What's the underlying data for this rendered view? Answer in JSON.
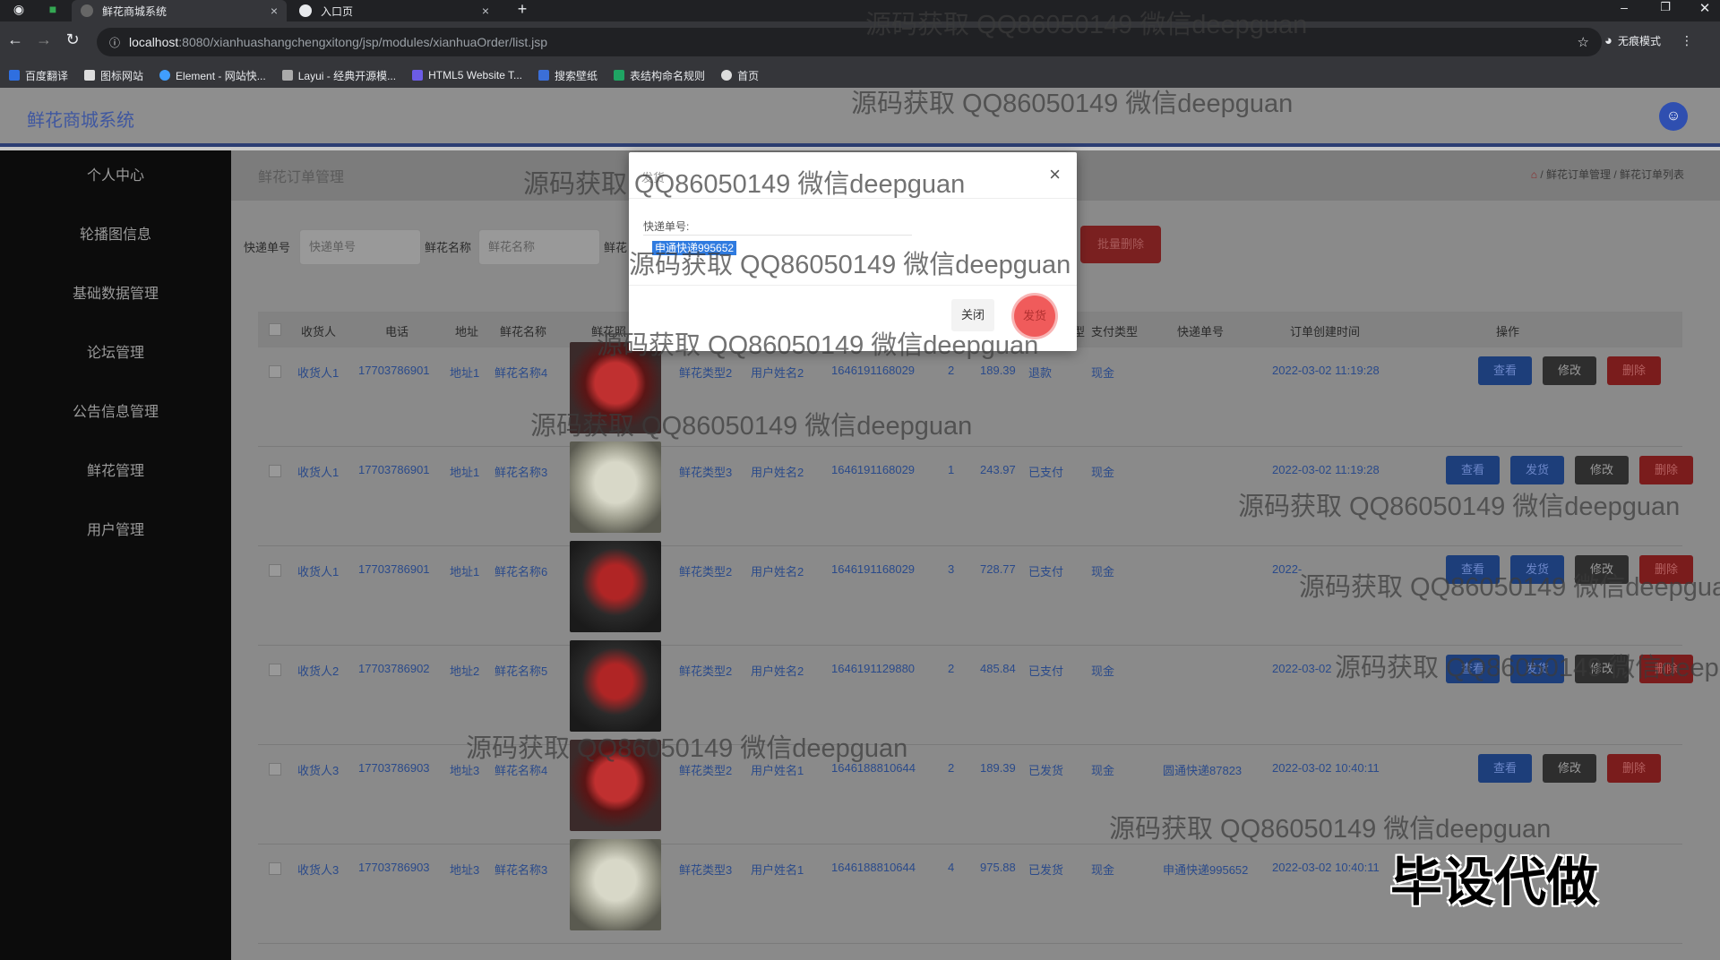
{
  "browser": {
    "tabs": [
      {
        "label": "鲜花商城系统",
        "close": "×"
      },
      {
        "label": "入口页",
        "close": "×"
      }
    ],
    "new_tab": "+",
    "url_host": "localhost",
    "url_path": ":8080/xianhuashangchengxitong/jsp/modules/xianhuaOrder/list.jsp",
    "incognito_label": "无痕模式",
    "bookmarks": [
      "百度翻译",
      "图标网站",
      "Element - 网站快...",
      "Layui - 经典开源模...",
      "HTML5 Website T...",
      "搜索壁纸",
      "表结构命名规则",
      "首页"
    ]
  },
  "app": {
    "title": "鲜花商城系统"
  },
  "sidebar": {
    "items": [
      "个人中心",
      "轮播图信息",
      "基础数据管理",
      "论坛管理",
      "公告信息管理",
      "鲜花管理",
      "用户管理"
    ]
  },
  "page": {
    "title": "鲜花订单管理",
    "breadcrumb": "/ 鲜花订单管理 / 鲜花订单列表"
  },
  "filters": {
    "courier_label": "快递单号",
    "courier_placeholder": "快递单号",
    "flower_label": "鲜花名称",
    "flower_placeholder": "鲜花名称",
    "third_label": "鲜花",
    "batch_delete": "批量删除"
  },
  "table": {
    "headers": [
      "收货人",
      "电话",
      "地址",
      "鲜花名称",
      "鲜花照",
      "型",
      "支付类型",
      "快递单号",
      "订单创建时间",
      "操作"
    ],
    "rows": [
      {
        "receiver": "收货人1",
        "phone": "17703786901",
        "address": "地址1",
        "flower": "鲜花名称4",
        "img": "red",
        "ftype": "鲜花类型2",
        "user": "用户姓名2",
        "order_no": "1646191168029",
        "qty": "2",
        "price": "189.39",
        "status": "退款",
        "pay": "现金",
        "courier": "",
        "created": "2022-03-02 11:19:28",
        "actions": [
          "查看",
          "修改",
          "删除"
        ]
      },
      {
        "receiver": "收货人1",
        "phone": "17703786901",
        "address": "地址1",
        "flower": "鲜花名称3",
        "img": "white",
        "ftype": "鲜花类型3",
        "user": "用户姓名2",
        "order_no": "1646191168029",
        "qty": "1",
        "price": "243.97",
        "status": "已支付",
        "pay": "现金",
        "courier": "",
        "created": "2022-03-02 11:19:28",
        "actions": [
          "查看",
          "发货",
          "修改",
          "删除"
        ]
      },
      {
        "receiver": "收货人1",
        "phone": "17703786901",
        "address": "地址1",
        "flower": "鲜花名称6",
        "img": "dark",
        "ftype": "鲜花类型2",
        "user": "用户姓名2",
        "order_no": "1646191168029",
        "qty": "3",
        "price": "728.77",
        "status": "已支付",
        "pay": "现金",
        "courier": "",
        "created": "2022-",
        "actions": [
          "查看",
          "发货",
          "修改",
          "删除"
        ]
      },
      {
        "receiver": "收货人2",
        "phone": "17703786902",
        "address": "地址2",
        "flower": "鲜花名称5",
        "img": "dark",
        "ftype": "鲜花类型2",
        "user": "用户姓名2",
        "order_no": "1646191129880",
        "qty": "2",
        "price": "485.84",
        "status": "已支付",
        "pay": "现金",
        "courier": "",
        "created": "2022-03-02",
        "actions": [
          "查看",
          "发货",
          "修改",
          "删除"
        ]
      },
      {
        "receiver": "收货人3",
        "phone": "17703786903",
        "address": "地址3",
        "flower": "鲜花名称4",
        "img": "red",
        "ftype": "鲜花类型2",
        "user": "用户姓名1",
        "order_no": "1646188810644",
        "qty": "2",
        "price": "189.39",
        "status": "已发货",
        "pay": "现金",
        "courier": "圆通快递87823",
        "created": "2022-03-02 10:40:11",
        "actions": [
          "查看",
          "修改",
          "删除"
        ]
      },
      {
        "receiver": "收货人3",
        "phone": "17703786903",
        "address": "地址3",
        "flower": "鲜花名称3",
        "img": "white",
        "ftype": "鲜花类型3",
        "user": "用户姓名1",
        "order_no": "1646188810644",
        "qty": "4",
        "price": "975.88",
        "status": "已发货",
        "pay": "现金",
        "courier": "申通快递995652",
        "created": "2022-03-02 10:40:11",
        "actions": []
      }
    ]
  },
  "modal": {
    "title": "发货",
    "close_icon": "×",
    "field_label": "快递单号:",
    "field_value": "申通快递995652",
    "close_button": "关闭",
    "send_button": "发货"
  },
  "watermark": "源码获取 QQ86050149 微信deepguan",
  "brand_overlay": "毕设代做"
}
